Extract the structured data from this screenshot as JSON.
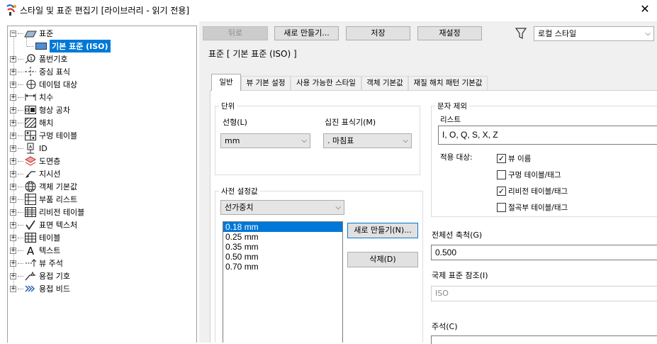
{
  "window": {
    "title": "스타일 및 표준 편집기 [라이브러리 - 읽기 전용]",
    "close": "✕"
  },
  "tree": {
    "root_label": "표준",
    "child_label": "기본 표준 (ISO)",
    "items": [
      {
        "label": "품번기호",
        "icon": "balloon-icon"
      },
      {
        "label": "중심 표식",
        "icon": "center-mark-icon"
      },
      {
        "label": "데이텀 대상",
        "icon": "datum-target-icon"
      },
      {
        "label": "치수",
        "icon": "dimension-icon"
      },
      {
        "label": "형상 공차",
        "icon": "feature-control-frame-icon"
      },
      {
        "label": "해치",
        "icon": "hatch-icon"
      },
      {
        "label": "구멍 테이블",
        "icon": "hole-table-icon"
      },
      {
        "label": "ID",
        "icon": "identifier-icon"
      },
      {
        "label": "도면층",
        "icon": "layer-icon"
      },
      {
        "label": "지시선",
        "icon": "leader-icon"
      },
      {
        "label": "객체 기본값",
        "icon": "object-defaults-icon"
      },
      {
        "label": "부품 리스트",
        "icon": "parts-list-icon"
      },
      {
        "label": "리비전 테이블",
        "icon": "revision-table-icon"
      },
      {
        "label": "표면 텍스처",
        "icon": "surface-texture-icon"
      },
      {
        "label": "테이블",
        "icon": "table-icon"
      },
      {
        "label": "텍스트",
        "icon": "text-icon"
      },
      {
        "label": "뷰 주석",
        "icon": "view-annotation-icon"
      },
      {
        "label": "용접 기호",
        "icon": "weld-symbol-icon"
      },
      {
        "label": "용접 비드",
        "icon": "weld-bead-icon"
      }
    ]
  },
  "toolbar": {
    "back_label": "뒤로",
    "new_label": "새로 만들기...",
    "save_label": "저장",
    "reset_label": "재설정",
    "style_filter_value": "로컬 스타일"
  },
  "section_title": "표준 [ 기본 표준 (ISO) ]",
  "tabs": [
    "일반",
    "뷰 기본 설정",
    "사용 가능한 스타일",
    "객체 기본값",
    "재질 해치 패턴 기본값"
  ],
  "units": {
    "legend": "단위",
    "linear_label": "선형(L)",
    "linear_value": "mm",
    "decimal_label": "십진 표식기(M)",
    "decimal_value": ". 마침표"
  },
  "presets": {
    "legend": "사전 설정값",
    "type_value": "선가중치",
    "items": [
      "0.18 mm",
      "0.25 mm",
      "0.35 mm",
      "0.50 mm",
      "0.70 mm"
    ],
    "new_button": "새로 만들기(N)...",
    "delete_button": "삭제(D)"
  },
  "char_exclusion": {
    "legend": "문자 제외",
    "list_label": "리스트",
    "list_value": "I, O, Q, S, X, Z",
    "apply_label": "적용 대상:",
    "options": [
      {
        "label": "뷰 이름",
        "checked": true
      },
      {
        "label": "구멍 테이블/태그",
        "checked": false
      },
      {
        "label": "리비전 테이블/태그",
        "checked": true
      },
      {
        "label": "절곡부 테이블/태그",
        "checked": false
      }
    ]
  },
  "global_scale": {
    "label": "전체선 축척(G)",
    "value": "0.500"
  },
  "intl_standard": {
    "label": "국제 표준 참조(I)",
    "value": "ISO"
  },
  "comment": {
    "label": "주석(C)",
    "value": ""
  }
}
